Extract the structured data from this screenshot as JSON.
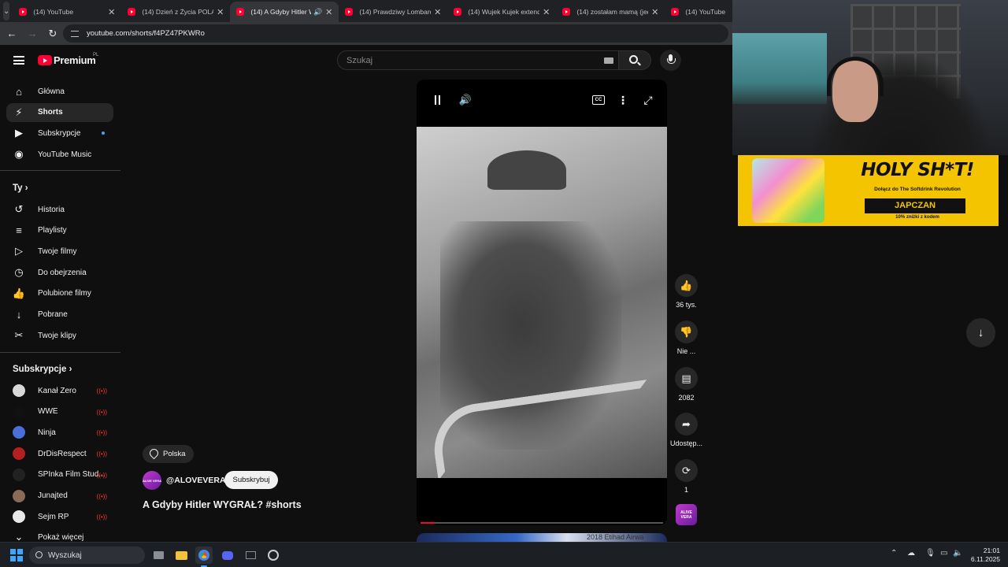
{
  "browser": {
    "tabs": [
      {
        "title": "(14) YouTube",
        "active": false
      },
      {
        "title": "(14) Dzień z Życia POLAKA",
        "active": false
      },
      {
        "title": "(14) A Gdyby Hitler W",
        "active": true,
        "audio": true
      },
      {
        "title": "(14) Prawdziwy Lombard",
        "active": false
      },
      {
        "title": "(14) Wujek Kujek extende",
        "active": false
      },
      {
        "title": "(14) zostałam mamą (jedn",
        "active": false
      },
      {
        "title": "(14) YouTube",
        "active": false
      }
    ],
    "url": "youtube.com/shorts/f4PZ47PKWRo"
  },
  "header": {
    "logo_text": "Premium",
    "region": "PL",
    "search_placeholder": "Szukaj"
  },
  "sidebar": {
    "main": [
      {
        "label": "Główna",
        "icon": "home-icon",
        "glyph": "⌂"
      },
      {
        "label": "Shorts",
        "icon": "shorts-icon",
        "glyph": "⚡",
        "active": true
      },
      {
        "label": "Subskrypcje",
        "icon": "subscriptions-icon",
        "glyph": "▶",
        "dot": true
      },
      {
        "label": "YouTube Music",
        "icon": "music-icon",
        "glyph": "◉"
      }
    ],
    "you_heading": "Ty",
    "you": [
      {
        "label": "Historia",
        "icon": "history-icon",
        "glyph": "↺"
      },
      {
        "label": "Playlisty",
        "icon": "playlist-icon",
        "glyph": "≡"
      },
      {
        "label": "Twoje filmy",
        "icon": "your-videos-icon",
        "glyph": "▷"
      },
      {
        "label": "Do obejrzenia",
        "icon": "watch-later-icon",
        "glyph": "◷"
      },
      {
        "label": "Polubione filmy",
        "icon": "liked-icon",
        "glyph": "👍"
      },
      {
        "label": "Pobrane",
        "icon": "download-icon",
        "glyph": "↓"
      },
      {
        "label": "Twoje klipy",
        "icon": "clips-icon",
        "glyph": "✂"
      }
    ],
    "subs_heading": "Subskrypcje",
    "subs": [
      {
        "label": "Kanał Zero",
        "avatar": "#d8d8d8",
        "live": true
      },
      {
        "label": "WWE",
        "avatar": "#111111",
        "live": true
      },
      {
        "label": "Ninja",
        "avatar": "#4a6fd8",
        "live": true
      },
      {
        "label": "DrDisRespect",
        "avatar": "#b32020",
        "live": true
      },
      {
        "label": "SPInka Film Stud...",
        "avatar": "#222222",
        "live": true
      },
      {
        "label": "Junajted",
        "avatar": "#8a6b55",
        "live": true
      },
      {
        "label": "Sejm RP",
        "avatar": "#e8e8e8",
        "live": true
      }
    ],
    "show_more": "Pokaż więcej"
  },
  "short": {
    "location": "Polska",
    "channel_handle": "@ALOVEVERA",
    "channel_avatar_text": "ALIVE VERA",
    "subscribe_label": "Subskrybuj",
    "title": "A Gdyby Hitler WYGRAŁ? #shorts",
    "progress": 0.06,
    "next_peek_text": "2018 Etihad Airwa"
  },
  "actions": {
    "likes": "36 tys.",
    "dislike": "Nie ...",
    "comments": "2082",
    "share": "Udostęp...",
    "remix": "1"
  },
  "overlay": {
    "promo_headline": "HOLY SH*T!",
    "promo_sub": "Dołącz do The Softdrink Revolution",
    "promo_code": "JAPCZAN",
    "promo_note": "10% zniżki z kodem"
  },
  "taskbar": {
    "search_label": "Wyszukaj",
    "time": "21:01",
    "date": "6.11.2025"
  },
  "colors": {
    "background": "#0f0f0f",
    "youtube_red": "#ff0033",
    "promo_yellow": "#f5c400"
  }
}
